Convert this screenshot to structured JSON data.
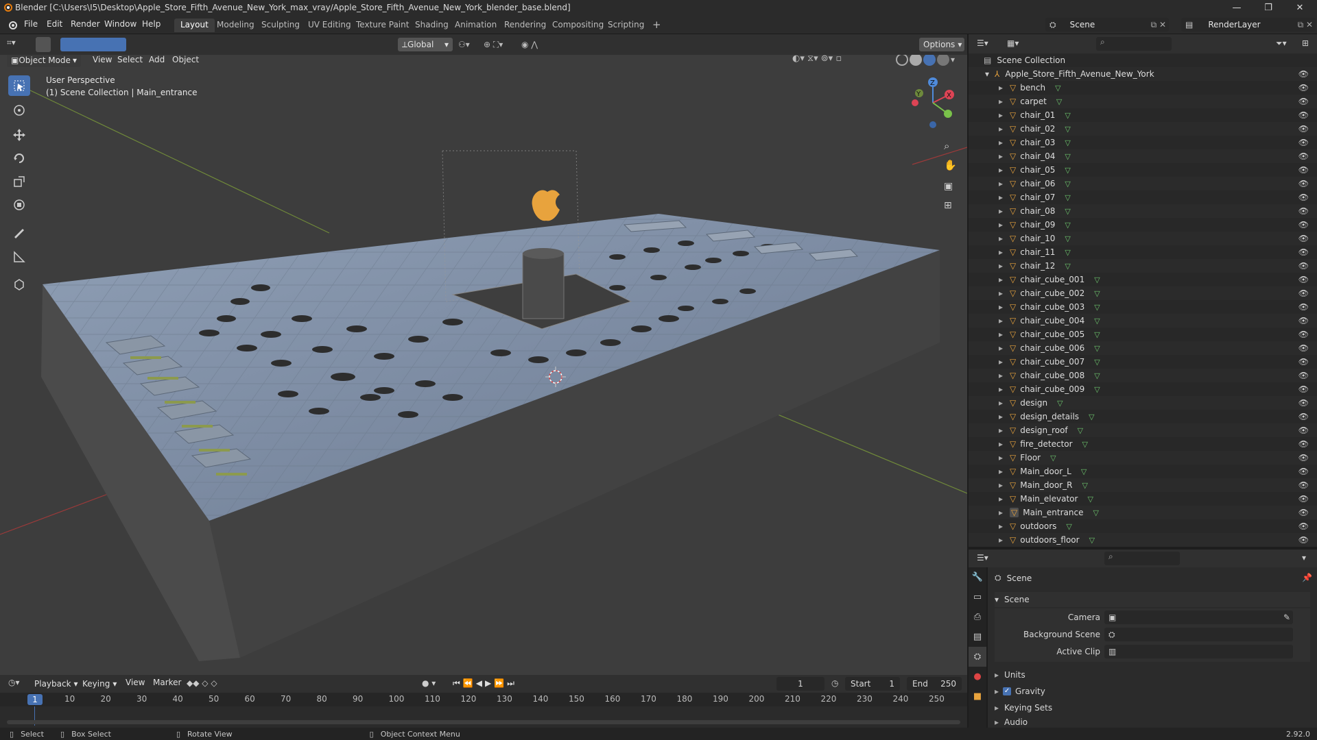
{
  "window": {
    "title": "Blender [C:\\Users\\I5\\Desktop\\Apple_Store_Fifth_Avenue_New_York_max_vray/Apple_Store_Fifth_Avenue_New_York_blender_base.blend]",
    "minimize": "—",
    "maximize": "❐",
    "close": "✕"
  },
  "menubar": {
    "items": [
      "File",
      "Edit",
      "Render",
      "Window",
      "Help"
    ],
    "workspaces": [
      "Layout",
      "Modeling",
      "Sculpting",
      "UV Editing",
      "Texture Paint",
      "Shading",
      "Animation",
      "Rendering",
      "Compositing",
      "Scripting"
    ],
    "add_workspace": "+",
    "scene_label": "Scene",
    "layer_label": "RenderLayer"
  },
  "viewport_header": {
    "mode": "Object Mode",
    "menus": [
      "View",
      "Select",
      "Add",
      "Object"
    ],
    "orientation": "Global",
    "options": "Options"
  },
  "viewport": {
    "perspective": "User Perspective",
    "collection_info": "(1) Scene Collection | Main_entrance",
    "gizmo": {
      "x": "X",
      "y": "Y",
      "z": "Z"
    }
  },
  "outliner": {
    "root": "Scene Collection",
    "collection": "Apple_Store_Fifth_Avenue_New_York",
    "items": [
      "bench",
      "carpet",
      "chair_01",
      "chair_02",
      "chair_03",
      "chair_04",
      "chair_05",
      "chair_06",
      "chair_07",
      "chair_08",
      "chair_09",
      "chair_10",
      "chair_11",
      "chair_12",
      "chair_cube_001",
      "chair_cube_002",
      "chair_cube_003",
      "chair_cube_004",
      "chair_cube_005",
      "chair_cube_006",
      "chair_cube_007",
      "chair_cube_008",
      "chair_cube_009",
      "design",
      "design_details",
      "design_roof",
      "fire_detector",
      "Floor",
      "Main_door_L",
      "Main_door_R",
      "Main_elevator",
      "Main_entrance",
      "outdoors",
      "outdoors_floor"
    ],
    "selected": "Main_entrance"
  },
  "properties": {
    "context": "Scene",
    "panel": "Scene",
    "fields": [
      {
        "label": "Camera"
      },
      {
        "label": "Background Scene"
      },
      {
        "label": "Active Clip"
      }
    ],
    "subpanels": [
      "Units",
      "Gravity",
      "Keying Sets",
      "Audio"
    ]
  },
  "timeline": {
    "menus": [
      "Playback",
      "Keying",
      "View",
      "Marker"
    ],
    "current_frame": "1",
    "start_label": "Start",
    "start": "1",
    "end_label": "End",
    "end": "250",
    "ticks": [
      "10",
      "20",
      "30",
      "40",
      "50",
      "60",
      "70",
      "80",
      "90",
      "100",
      "110",
      "120",
      "130",
      "140",
      "150",
      "160",
      "170",
      "180",
      "190",
      "200",
      "210",
      "220",
      "230",
      "240",
      "250"
    ],
    "playhead": "1"
  },
  "statusbar": {
    "select": "Select",
    "box_select": "Box Select",
    "rotate": "Rotate View",
    "context_menu": "Object Context Menu",
    "version": "2.92.0"
  },
  "colors": {
    "accent": "#4772b3",
    "object_orange": "#e8a33d",
    "mesh_green": "#6dc46d"
  }
}
